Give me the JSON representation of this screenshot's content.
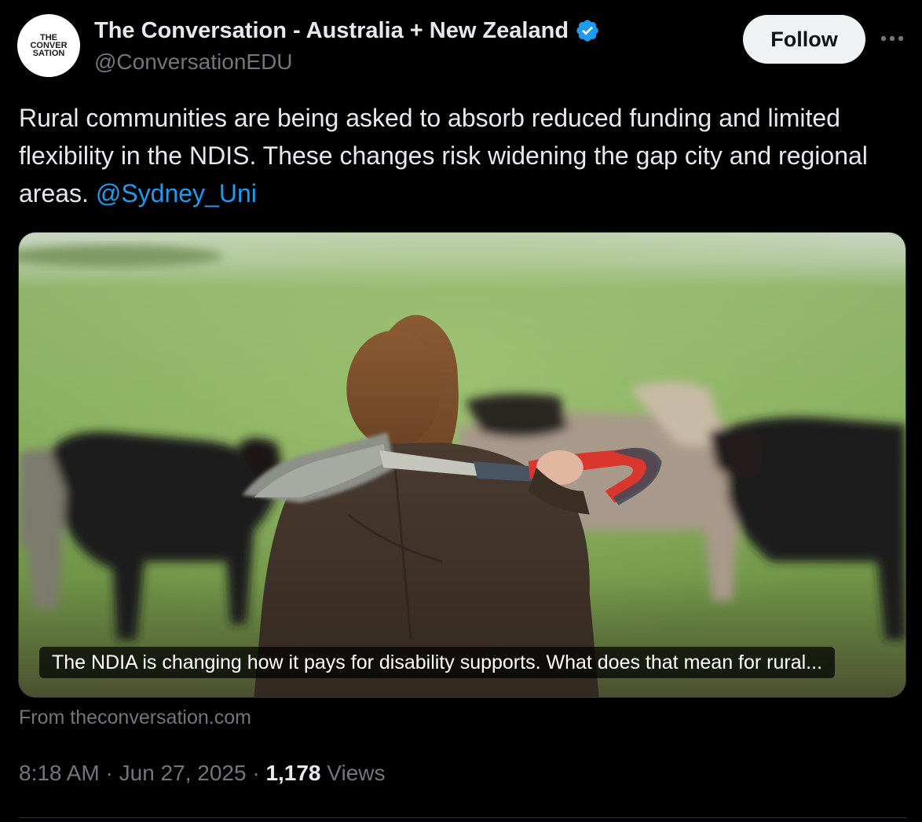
{
  "author": {
    "avatar_logo_lines": [
      "THE",
      "CONVER",
      "SATION"
    ],
    "name": "The Conversation - Australia + New Zealand",
    "handle": "@ConversationEDU",
    "verified_icon": "verified-badge-icon"
  },
  "actions": {
    "follow_label": "Follow",
    "more_icon": "more-dots-icon"
  },
  "tweet": {
    "text": "Rural communities are being asked to absorb reduced funding and limited flexibility in the NDIS. These changes risk widening the gap city and regional areas. ",
    "mention": "@Sydney_Uni"
  },
  "card": {
    "image_subject": "Farmer with shovel over shoulder facing cattle in a green field",
    "caption": "The NDIA is changing how it pays for disability supports. What does that mean for rural...",
    "source": "From theconversation.com"
  },
  "meta": {
    "time": "8:18 AM",
    "separator": "·",
    "date": "Jun 27, 2025",
    "views_count": "1,178",
    "views_label": "Views"
  },
  "colors": {
    "background": "#000000",
    "primary_text": "#e7e9ea",
    "secondary_text": "#71767b",
    "link": "#1d9bf0",
    "verified": "#1d9bf0",
    "follow_bg": "#eff3f4",
    "border": "#2f3336"
  }
}
